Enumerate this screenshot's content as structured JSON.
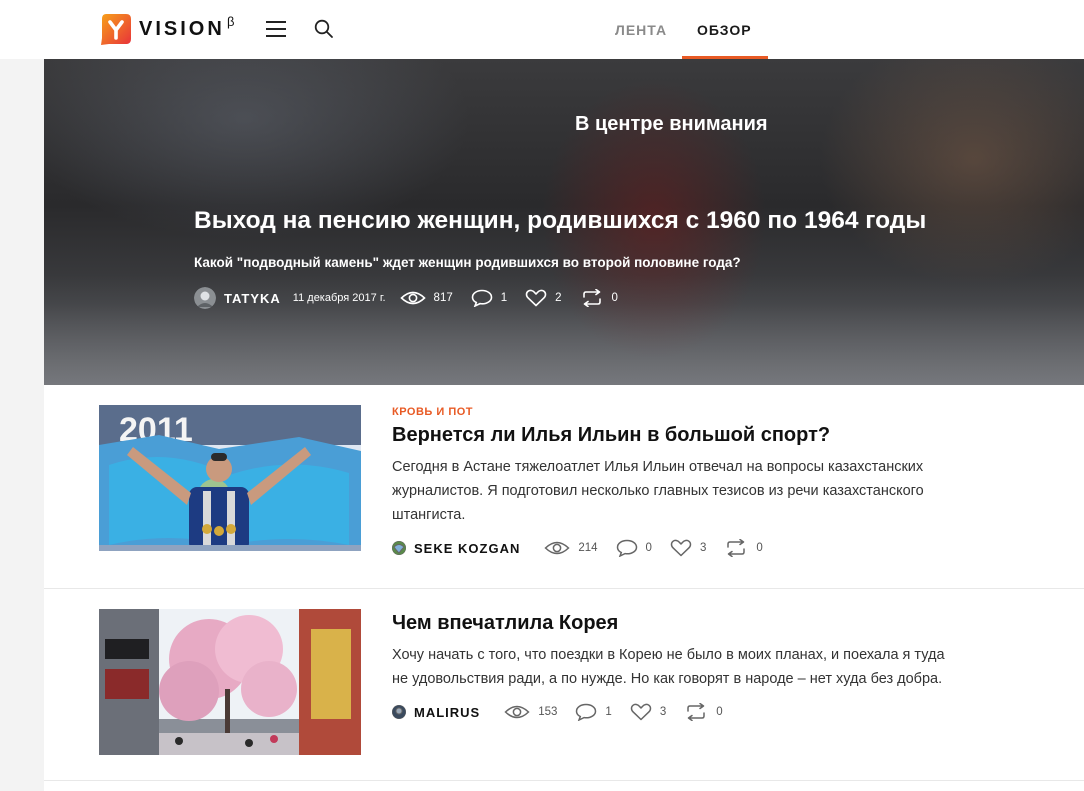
{
  "brand": {
    "name": "VISION",
    "badge": "β"
  },
  "nav": {
    "tabs": [
      {
        "label": "ЛЕНТА"
      },
      {
        "label": "ОБЗОР"
      }
    ],
    "active": "ОБЗОР",
    "accent": "#e85a24"
  },
  "hero": {
    "kicker": "В центре внимания",
    "title": "Выход на пенсию женщин, родившихся с 1960 по 1964 годы",
    "subtitle": "Какой \"подводный камень\" ждет женщин родившихся во второй половине года?",
    "author": "TATYKA",
    "date": "11 декабря 2017 г.",
    "views": "817",
    "comments": "1",
    "likes": "2",
    "reposts": "0"
  },
  "articles": [
    {
      "category": "КРОВЬ И ПОТ",
      "title": "Вернется ли Илья Ильин в большой спорт?",
      "excerpt": "Сегодня в Астане тяжелоатлет Илья Ильин отвечал на вопросы казахстанских журналистов. Я подготовил несколько главных тезисов из речи казахстанского штангиста.",
      "author": "SEKE KOZGAN",
      "views": "214",
      "comments": "0",
      "likes": "3",
      "reposts": "0"
    },
    {
      "category": "",
      "title": "Чем впечатлила Корея",
      "excerpt": "Хочу начать с того, что поездки в Корею не было в моих планах, и поехала я туда не удовольствия ради, а по нужде. Но как говорят в народе – нет худа без добра.",
      "author": "MALIRUS",
      "views": "153",
      "comments": "1",
      "likes": "3",
      "reposts": "0"
    }
  ],
  "icons": {
    "menu": "hamburger-icon",
    "search": "search-icon",
    "views": "eye-icon",
    "comments": "comment-icon",
    "likes": "heart-icon",
    "reposts": "repost-icon"
  }
}
